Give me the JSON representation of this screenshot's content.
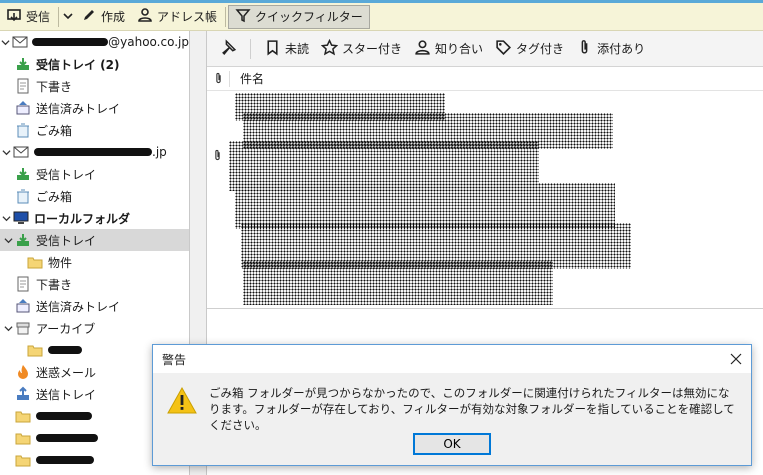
{
  "toolbar": {
    "receive_label": "受信",
    "compose_label": "作成",
    "addressbook_label": "アドレス帳",
    "quickfilter_label": "クイックフィルター"
  },
  "folders": {
    "acct1_email": "@yahoo.co.jp",
    "acct1_inbox": "受信トレイ (2)",
    "acct1_drafts": "下書き",
    "acct1_sent": "送信済みトレイ",
    "acct1_trash": "ごみ箱",
    "acct2_email": ".jp",
    "acct2_inbox": "受信トレイ",
    "acct2_trash": "ごみ箱",
    "local_label": "ローカルフォルダ",
    "local_inbox": "受信トレイ",
    "local_sub": "物件",
    "local_drafts": "下書き",
    "local_sent": "送信済みトレイ",
    "archive": "アーカイブ",
    "junk": "迷惑メール",
    "outbox": "送信トレイ"
  },
  "quickfilter": {
    "unread": "未読",
    "starred": "スター付き",
    "contact": "知り合い",
    "tagged": "タグ付き",
    "attachment": "添付あり"
  },
  "message_list": {
    "subject_header": "件名"
  },
  "dialog": {
    "title": "警告",
    "message": "ごみ箱 フォルダーが見つからなかったので、このフォルダーに関連付けられたフィルターは無効になります。フォルダーが存在しており、フィルターが有効な対象フォルダーを指していることを確認してください。",
    "ok_label": "OK"
  },
  "colors": {
    "accent": "#0078d7",
    "toolbar_bg": "#f6f4d8",
    "selected_row": "#d8d8d8"
  }
}
